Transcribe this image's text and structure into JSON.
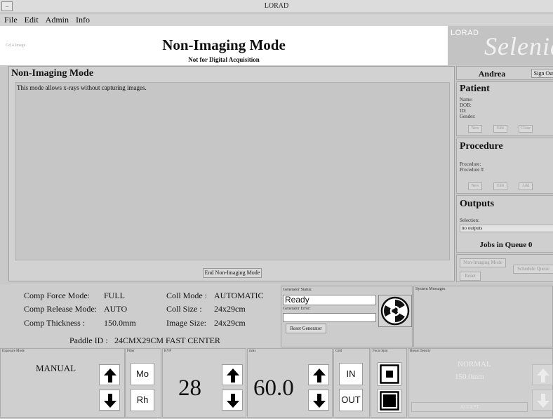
{
  "window": {
    "title": "LORAD"
  },
  "menu": [
    "File",
    "Edit",
    "Admin",
    "Info"
  ],
  "header": {
    "small_corner_text": "Gd 4 Image",
    "title": "Non-Imaging Mode",
    "subtitle": "Not for Digital Acquisition",
    "brand_small": "LORAD",
    "brand_large": "Selenia"
  },
  "main_panel": {
    "title": "Non-Imaging Mode",
    "description": "This mode allows x-rays without capturing images.",
    "end_button": "End Non-Imaging Mode"
  },
  "user": {
    "name": "Andrea",
    "sign_out": "Sign Out"
  },
  "patient": {
    "title": "Patient",
    "fields": [
      "Name:",
      "DOB:",
      "ID:",
      "Gender:"
    ],
    "buttons": [
      "New",
      "Edit",
      "Close"
    ]
  },
  "procedure": {
    "title": "Procedure",
    "fields": [
      "Procedure:",
      "Procedure #:"
    ],
    "buttons": [
      "New",
      "Edit",
      "Add"
    ]
  },
  "outputs": {
    "title": "Outputs",
    "selection_label": "Selection:",
    "selection_value": "no outputs",
    "jobs_label": "Jobs in Queue 0"
  },
  "queue_buttons": [
    "Non-Imaging Mode",
    "Schedule Queue",
    "Reset"
  ],
  "status": {
    "comp_force_label": "Comp Force  Mode:",
    "comp_force_value": "FULL",
    "comp_release_label": "Comp Release Mode:",
    "comp_release_value": "AUTO",
    "comp_thickness_label": "Comp Thickness  :",
    "comp_thickness_value": "150.0mm",
    "coll_mode_label": "Coll Mode :",
    "coll_mode_value": "AUTOMATIC",
    "coll_size_label": "Coll Size :",
    "coll_size_value": "24x29cm",
    "image_size_label": "Image Size:",
    "image_size_value": "24x29cm",
    "paddle_label": "Paddle ID :",
    "paddle_value": "24CMX29CM FAST CENTER"
  },
  "generator": {
    "status_label": "Generator Status:",
    "status_value": "Ready",
    "error_label": "Generator Error:",
    "error_value": "",
    "reset_button": "Reset Generator"
  },
  "system_messages": {
    "label": "System Messages"
  },
  "controls": {
    "exposure_mode": {
      "label": "Exposure Mode",
      "value": "MANUAL"
    },
    "filter": {
      "label": "Filter",
      "options": [
        "Mo",
        "Rh"
      ]
    },
    "kvp": {
      "label": "KVP",
      "value": "28"
    },
    "mas": {
      "label": "mAs",
      "value": "60.0"
    },
    "grid": {
      "label": "Grid",
      "options": [
        "IN",
        "OUT"
      ]
    },
    "focal_spot": {
      "label": "Focal Spot"
    },
    "breast_density": {
      "label": "Breast Density",
      "value": "NORMAL",
      "thickness": "150.0mm",
      "accept": "ACCEPT"
    }
  }
}
